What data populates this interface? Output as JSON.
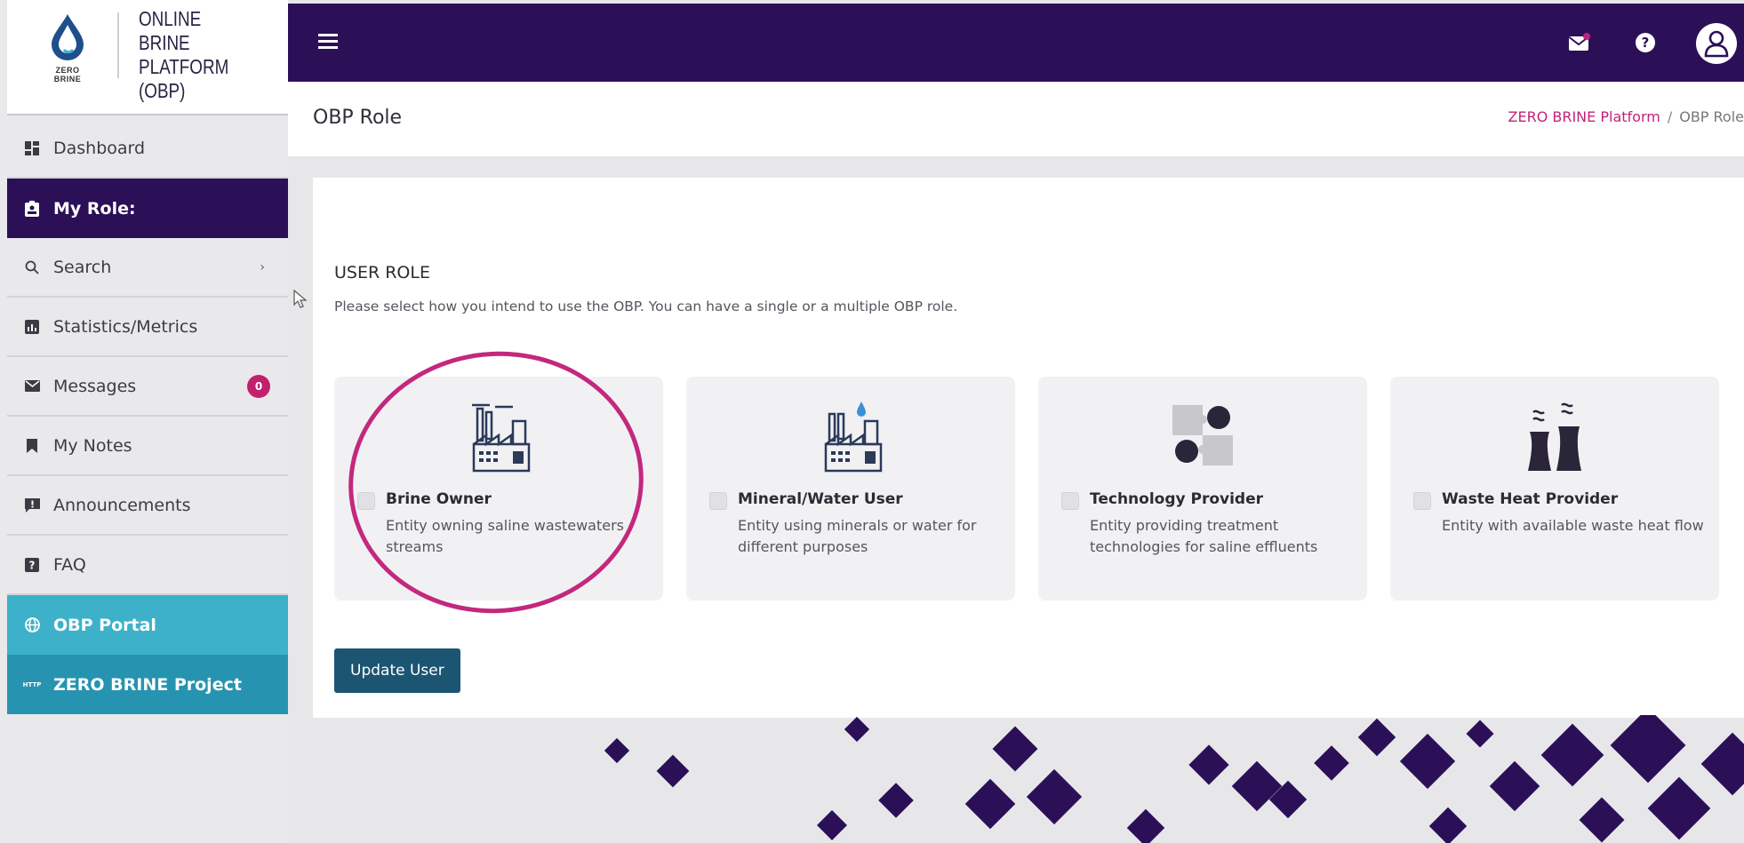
{
  "brand": {
    "logo_text": "ZERO BRINE",
    "title_lines": [
      "ONLINE",
      "BRINE",
      "PLATFORM (OBP)"
    ]
  },
  "sidebar": {
    "items": [
      {
        "label": "Dashboard",
        "icon": "dashboard-icon"
      },
      {
        "label": "My Role:",
        "icon": "id-card-icon"
      },
      {
        "label": "Search",
        "icon": "search-icon",
        "chevron": "›"
      },
      {
        "label": "Statistics/Metrics",
        "icon": "chart-icon"
      },
      {
        "label": "Messages",
        "icon": "envelope-icon",
        "badge": "0"
      },
      {
        "label": "My Notes",
        "icon": "bookmark-icon"
      },
      {
        "label": "Announcements",
        "icon": "announcement-icon"
      },
      {
        "label": "FAQ",
        "icon": "question-icon"
      },
      {
        "label": "OBP Portal",
        "icon": "globe-icon"
      },
      {
        "label": "ZERO BRINE Project",
        "icon": "link-icon",
        "icon_text": "HTTP"
      }
    ]
  },
  "topbar": {
    "help_glyph": "?"
  },
  "page": {
    "title": "OBP Role",
    "breadcrumb": {
      "root": "ZERO BRINE Platform",
      "separator": "/",
      "current": "OBP Role"
    }
  },
  "user_role": {
    "heading": "USER ROLE",
    "description": "Please select how you intend to use the OBP. You can have a single or a multiple OBP role.",
    "roles": [
      {
        "name": "Brine Owner",
        "description": "Entity owning saline wastewaters streams",
        "icon": "factory-icon",
        "checked": false
      },
      {
        "name": "Mineral/Water User",
        "description": "Entity using minerals or water for different purposes",
        "icon": "factory-water-icon",
        "checked": false
      },
      {
        "name": "Technology Provider",
        "description": "Entity providing treatment technologies for saline effluents",
        "icon": "puzzle-icon",
        "checked": false
      },
      {
        "name": "Waste Heat Provider",
        "description": "Entity with available waste heat flow",
        "icon": "cooling-tower-icon",
        "checked": false
      }
    ],
    "submit_label": "Update User"
  },
  "colors": {
    "primary": "#2b1058",
    "accent": "#c1237a",
    "portal": "#3db1c9",
    "project": "#2694b0",
    "button": "#1c5572",
    "annotation": "#c3287e"
  }
}
